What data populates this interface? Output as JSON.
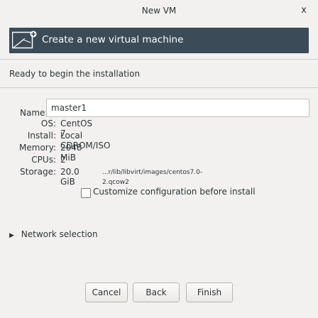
{
  "window": {
    "title": "New VM",
    "close_glyph": "x"
  },
  "banner": {
    "title": "Create a new virtual machine",
    "icon": "vm-monitor-icon"
  },
  "status": {
    "text": "Ready to begin the installation"
  },
  "name_field": {
    "label": "Name:",
    "value": "master1"
  },
  "details": {
    "os_label": "OS:",
    "os_value": "CentOS 7",
    "install_label": "Install:",
    "install_value": "Local CDROM/ISO",
    "memory_label": "Memory:",
    "memory_value": "2048 MiB",
    "cpus_label": "CPUs:",
    "cpus_value": "2",
    "storage_label": "Storage:",
    "storage_size": "20.0 GiB",
    "storage_path": "...r/lib/libvirt/images/centos7.0-2.qcow2"
  },
  "customize": {
    "label": "Customize configuration before install",
    "checked": false
  },
  "network": {
    "label": "Network selection",
    "icon": "triangle-right-icon"
  },
  "buttons": {
    "cancel": "Cancel",
    "back": "Back",
    "finish": "Finish"
  }
}
